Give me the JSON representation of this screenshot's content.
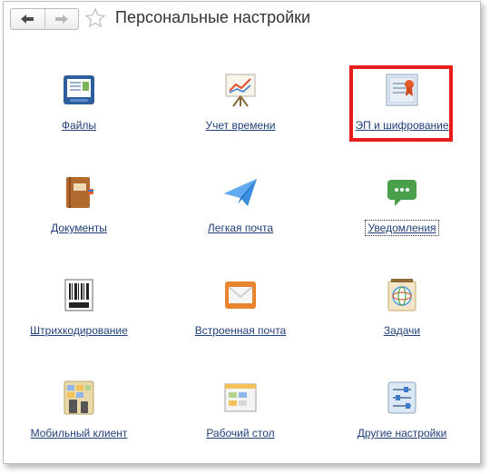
{
  "window": {
    "title": "Персональные настройки"
  },
  "nav": {
    "back_icon": "arrow-left-icon",
    "forward_icon": "arrow-right-icon",
    "favorite_icon": "star-icon"
  },
  "colors": {
    "link": "#21407a",
    "highlight": "#e81c1c"
  },
  "tiles": [
    {
      "label": "Файлы",
      "icon": "files-icon"
    },
    {
      "label": "Учет времени",
      "icon": "time-tracking-icon"
    },
    {
      "label": "ЭП и шифрование",
      "icon": "certificate-icon"
    },
    {
      "label": "Документы",
      "icon": "documents-icon"
    },
    {
      "label": "Легкая почта",
      "icon": "paper-plane-icon"
    },
    {
      "label": "Уведомления",
      "icon": "notifications-icon"
    },
    {
      "label": "Штрихкодирование",
      "icon": "barcode-icon"
    },
    {
      "label": "Встроенная почта",
      "icon": "mail-icon"
    },
    {
      "label": "Задачи",
      "icon": "tasks-icon"
    },
    {
      "label": "Мобильный клиент",
      "icon": "mobile-client-icon"
    },
    {
      "label": "Рабочий стол",
      "icon": "desktop-icon"
    },
    {
      "label": "Другие настройки",
      "icon": "other-settings-icon"
    }
  ]
}
